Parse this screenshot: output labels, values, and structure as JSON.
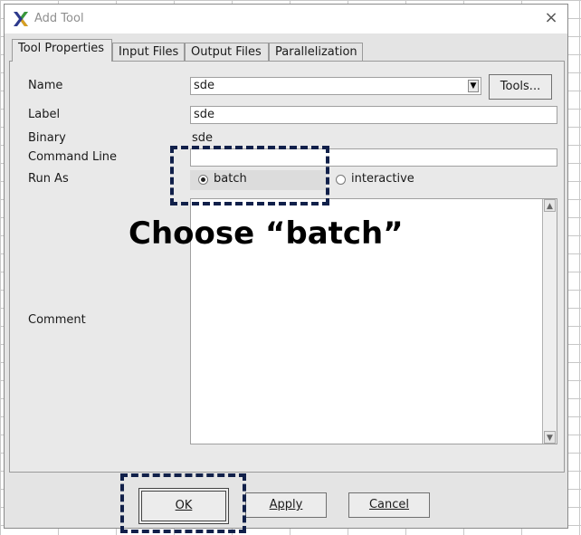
{
  "window": {
    "title": "Add Tool",
    "close": "×"
  },
  "tabs": [
    {
      "label": "Tool Properties"
    },
    {
      "label": "Input Files"
    },
    {
      "label": "Output Files"
    },
    {
      "label": "Parallelization"
    }
  ],
  "form": {
    "name_label": "Name",
    "name_value": "sde",
    "tools_button": "Tools...",
    "label_label": "Label",
    "label_value": "sde",
    "binary_label": "Binary",
    "binary_value": "sde",
    "command_line_label": "Command Line",
    "command_line_value": "",
    "run_as_label": "Run As",
    "run_as_options": [
      {
        "label": "batch",
        "selected": true
      },
      {
        "label": "interactive",
        "selected": false
      }
    ],
    "comment_label": "Comment",
    "comment_value": ""
  },
  "buttons": {
    "ok": "OK",
    "apply": "Apply",
    "cancel": "Cancel"
  },
  "annotation": {
    "callout": "Choose “batch”",
    "color": "#11204a"
  },
  "icons": {
    "app": "x-logo-icon",
    "close": "close-icon"
  }
}
